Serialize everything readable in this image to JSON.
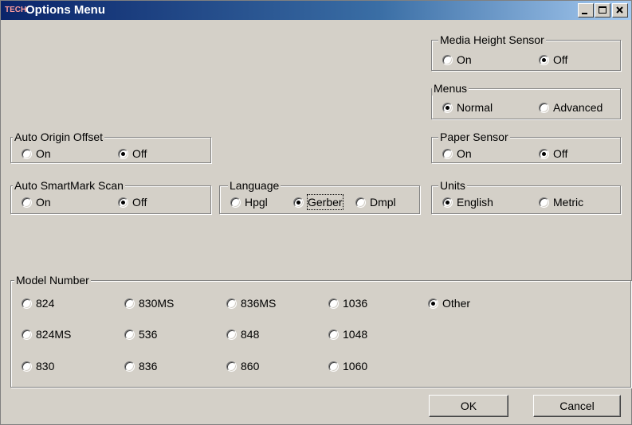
{
  "window": {
    "title": "Options Menu",
    "icon_text": "TECH"
  },
  "media_height_sensor": {
    "label": "Media Height Sensor",
    "options": [
      "On",
      "Off"
    ],
    "selected": "Off"
  },
  "menus": {
    "label": "Menus",
    "options": [
      "Normal",
      "Advanced"
    ],
    "selected": "Normal"
  },
  "auto_origin_offset": {
    "label": "Auto Origin Offset",
    "options": [
      "On",
      "Off"
    ],
    "selected": "Off"
  },
  "paper_sensor": {
    "label": "Paper Sensor",
    "options": [
      "On",
      "Off"
    ],
    "selected": "Off"
  },
  "auto_smartmark_scan": {
    "label": "Auto SmartMark Scan",
    "options": [
      "On",
      "Off"
    ],
    "selected": "Off"
  },
  "language": {
    "label": "Language",
    "options": [
      "Hpgl",
      "Gerber",
      "Dmpl"
    ],
    "selected": "Gerber"
  },
  "units": {
    "label": "Units",
    "options": [
      "English",
      "Metric"
    ],
    "selected": "English"
  },
  "model_number": {
    "label": "Model Number",
    "options": [
      "824",
      "830MS",
      "836MS",
      "1036",
      "Other",
      "824MS",
      "536",
      "848",
      "1048",
      "830",
      "836",
      "860",
      "1060"
    ],
    "selected": "Other"
  },
  "buttons": {
    "ok": "OK",
    "cancel": "Cancel"
  }
}
